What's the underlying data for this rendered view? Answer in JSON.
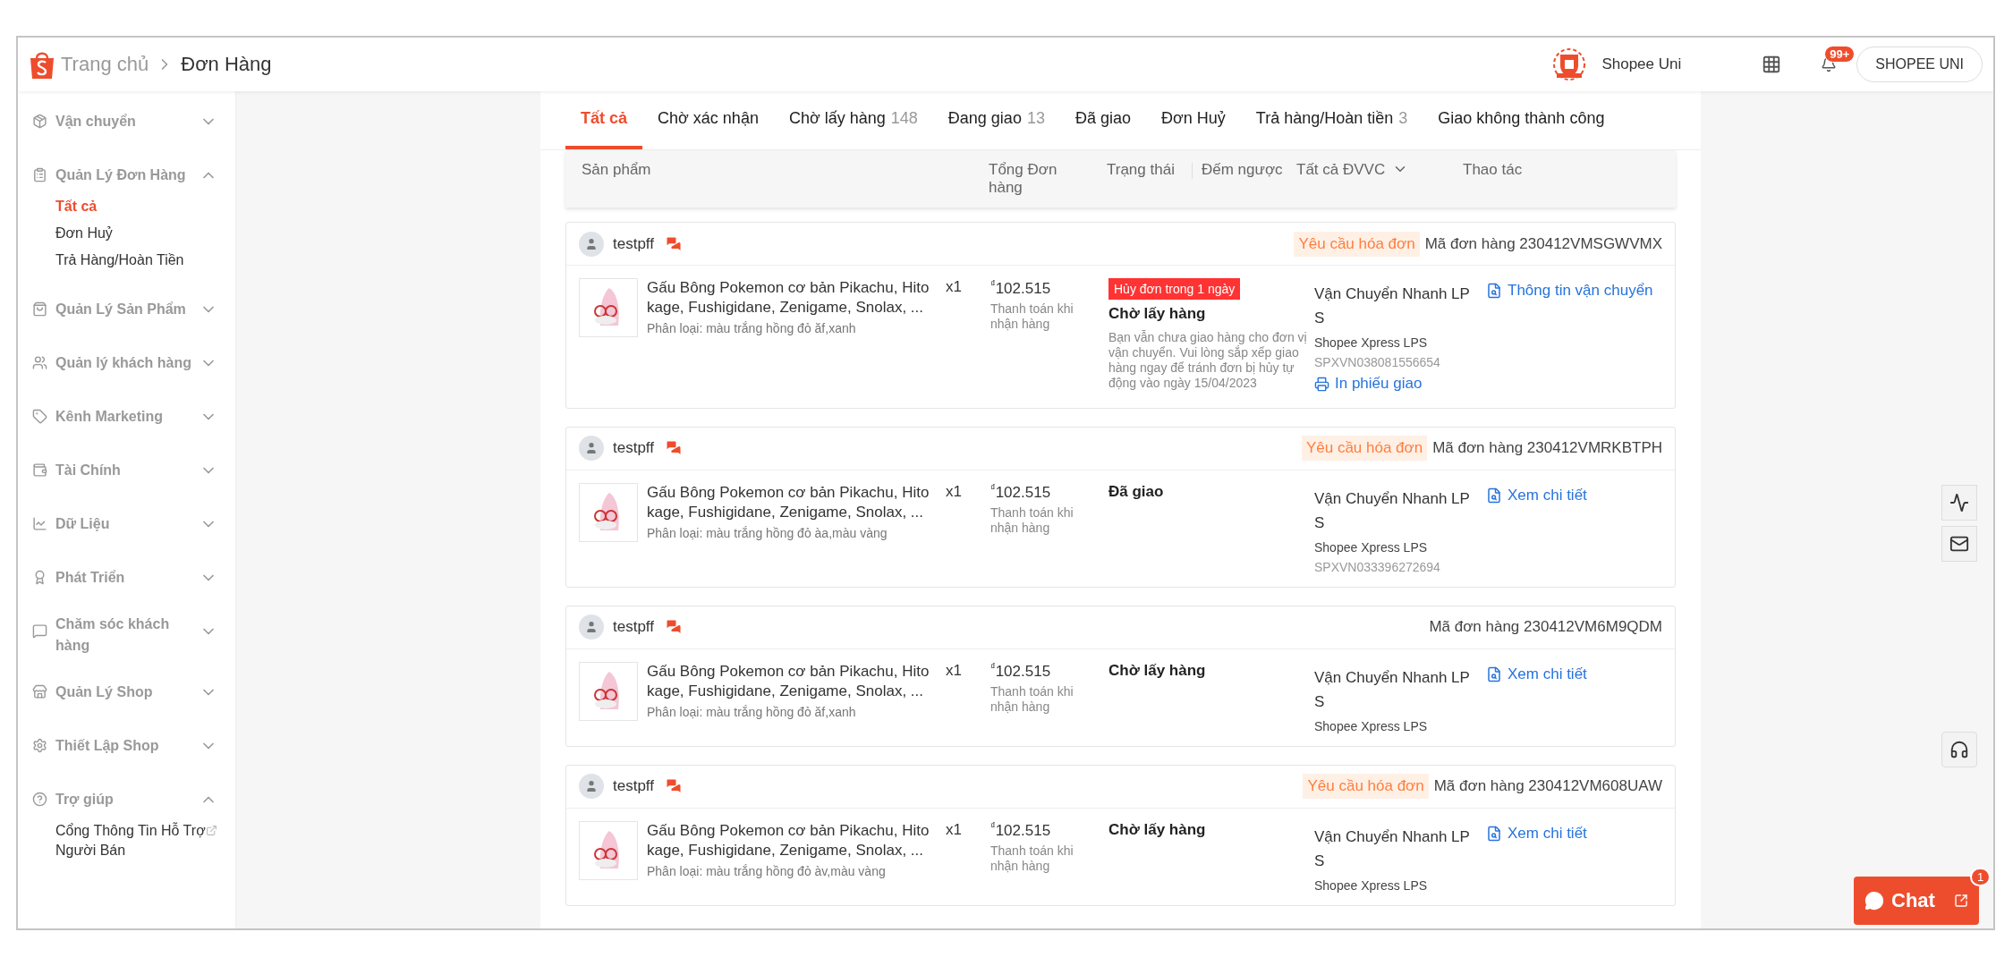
{
  "header": {
    "breadcrumb": [
      "Trang chủ",
      "Đơn Hàng"
    ],
    "shop_name": "Shopee Uni",
    "notification_badge": "99+",
    "account_button": "SHOPEE UNI"
  },
  "sidebar": [
    {
      "label": "Vận chuyển",
      "expanded": false
    },
    {
      "label": "Quản Lý Đơn Hàng",
      "expanded": true,
      "children": [
        {
          "label": "Tất cả",
          "selected": true,
          "external": false
        },
        {
          "label": "Đơn Huỷ",
          "selected": false,
          "external": false
        },
        {
          "label": "Trả Hàng/Hoàn Tiền",
          "selected": false,
          "external": false
        }
      ]
    },
    {
      "label": "Quản Lý Sản Phẩm",
      "expanded": false
    },
    {
      "label": "Quản lý khách hàng",
      "expanded": false
    },
    {
      "label": "Kênh Marketing",
      "expanded": false
    },
    {
      "label": "Tài Chính",
      "expanded": false
    },
    {
      "label": "Dữ Liệu",
      "expanded": false
    },
    {
      "label": "Phát Triển",
      "expanded": false
    },
    {
      "label": "Chăm sóc khách hàng",
      "expanded": false
    },
    {
      "label": "Quản Lý Shop",
      "expanded": false
    },
    {
      "label": "Thiết Lập Shop",
      "expanded": false
    },
    {
      "label": "Trợ giúp",
      "expanded": true,
      "children": [
        {
          "label": "Cổng Thông Tin Hỗ Trợ Người Bán",
          "selected": false,
          "external": true
        }
      ]
    }
  ],
  "tabs": [
    {
      "label": "Tất cả",
      "selected": true
    },
    {
      "label": "Chờ xác nhận",
      "selected": false
    },
    {
      "label": "Chờ lấy hàng",
      "count": "148",
      "selected": false
    },
    {
      "label": "Đang giao",
      "count": "13",
      "selected": false
    },
    {
      "label": "Đã giao",
      "selected": false
    },
    {
      "label": "Đơn Huỷ",
      "selected": false
    },
    {
      "label": "Trả hàng/Hoàn tiền",
      "count": "3",
      "selected": false
    },
    {
      "label": "Giao không thành công",
      "selected": false
    }
  ],
  "table_header": {
    "product": "Sản phẩm",
    "total": "Tổng Đơn hàng",
    "status": "Trạng thái",
    "countdown": "Đếm ngược",
    "carrier_filter": "Tất cả ĐVVC",
    "actions": "Thao tác"
  },
  "orders": [
    {
      "buyer": "testpff",
      "invoice_request": "Yêu cầu hóa đơn",
      "order_id": "Mã đơn hàng 230412VMSGWVMX",
      "product_name": "Gấu Bông Pokemon cơ bản Pikachu, Hitokage, Fushigidane, Zenigame, Snolax, ...",
      "variation": "Phân loại: màu trắng hồng đỏ ăf,xanh",
      "quantity": "x1",
      "price": "$^{₫}$102.515",
      "payment": "Thanh toán khi nhận hàng",
      "deadline_badge": "Hủy đơn trong 1 ngày",
      "status": "Chờ lấy hàng",
      "status_note": "Bạn vẫn chưa giao hàng cho đơn vị vận chuyển. Vui lòng sắp xếp giao hàng ngay để tránh đơn bị hủy tự động vào ngày 15/04/2023",
      "carrier": "Vận Chuyển Nhanh LPS",
      "shipping_service": "Shopee Xpress LPS",
      "tracking": "SPXVN038081556654",
      "print_link": "In phiếu giao",
      "action": "Thông tin vận chuyển"
    },
    {
      "buyer": "testpff",
      "invoice_request": "Yêu cầu hóa đơn",
      "order_id": "Mã đơn hàng 230412VMRKBTPH",
      "product_name": "Gấu Bông Pokemon cơ bản Pikachu, Hitokage, Fushigidane, Zenigame, Snolax, ...",
      "variation": "Phân loại: màu trắng hồng đỏ àa,màu vàng",
      "quantity": "x1",
      "price": "$^{₫}$102.515",
      "payment": "Thanh toán khi nhận hàng",
      "status": "Đã giao",
      "carrier": "Vận Chuyển Nhanh LPS",
      "shipping_service": "Shopee Xpress LPS",
      "tracking": "SPXVN033396272694",
      "action": "Xem chi tiết"
    },
    {
      "buyer": "testpff",
      "order_id": "Mã đơn hàng 230412VM6M9QDM",
      "product_name": "Gấu Bông Pokemon cơ bản Pikachu, Hitokage, Fushigidane, Zenigame, Snolax, ...",
      "variation": "Phân loại: màu trắng hồng đỏ ăf,xanh",
      "quantity": "x1",
      "price": "$^{₫}$102.515",
      "payment": "Thanh toán khi nhận hàng",
      "status": "Chờ lấy hàng",
      "carrier": "Vận Chuyển Nhanh LPS",
      "shipping_service": "Shopee Xpress LPS",
      "action": "Xem chi tiết"
    },
    {
      "buyer": "testpff",
      "invoice_request": "Yêu cầu hóa đơn",
      "order_id": "Mã đơn hàng 230412VM608UAW",
      "product_name": "Gấu Bông Pokemon cơ bản Pikachu, Hitokage, Fushigidane, Zenigame, Snolax, ...",
      "variation": "Phân loại: màu trắng hồng đỏ àv,màu vàng",
      "quantity": "x1",
      "price": "$^{₫}$102.515",
      "payment": "Thanh toán khi nhận hàng",
      "status": "Chờ lấy hàng",
      "carrier": "Vận Chuyển Nhanh LPS",
      "shipping_service": "Shopee Xpress LPS",
      "action": "Xem chi tiết"
    }
  ],
  "chat": {
    "label": "Chat",
    "badge": "1"
  }
}
